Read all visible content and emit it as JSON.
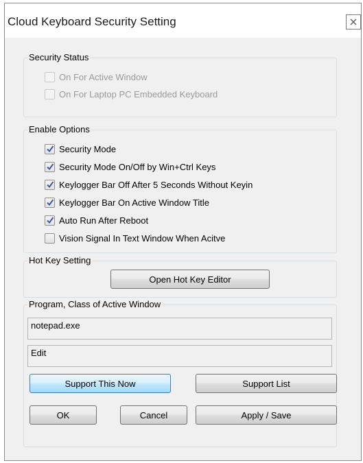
{
  "window": {
    "title": "Cloud Keyboard Security Setting"
  },
  "security_status": {
    "label": "Security Status",
    "items": [
      {
        "label": "On For Active Window",
        "checked": false,
        "enabled": false
      },
      {
        "label": "On For Laptop PC Embedded Keyboard",
        "checked": false,
        "enabled": false
      }
    ]
  },
  "enable_options": {
    "label": "Enable Options",
    "items": [
      {
        "label": "Security Mode",
        "checked": true
      },
      {
        "label": "Security Mode On/Off by Win+Ctrl Keys",
        "checked": true
      },
      {
        "label": "Keylogger Bar Off After 5 Seconds Without Keyin",
        "checked": true
      },
      {
        "label": "Keylogger Bar On Active Window Title",
        "checked": true
      },
      {
        "label": "Auto Run After Reboot",
        "checked": true
      },
      {
        "label": "Vision Signal In Text Window When Acitve",
        "checked": false
      }
    ]
  },
  "hotkey": {
    "label": "Hot Key Setting",
    "button": "Open Hot Key Editor"
  },
  "program": {
    "label": "Program, Class of Active Window",
    "program_value": "notepad.exe",
    "class_value": "Edit",
    "support_now": "Support This Now",
    "support_list": "Support List"
  },
  "footer": {
    "ok": "OK",
    "cancel": "Cancel",
    "apply": "Apply / Save"
  },
  "colors": {
    "checkmark": "#3a58a8",
    "default_button": "#bee6fd"
  }
}
